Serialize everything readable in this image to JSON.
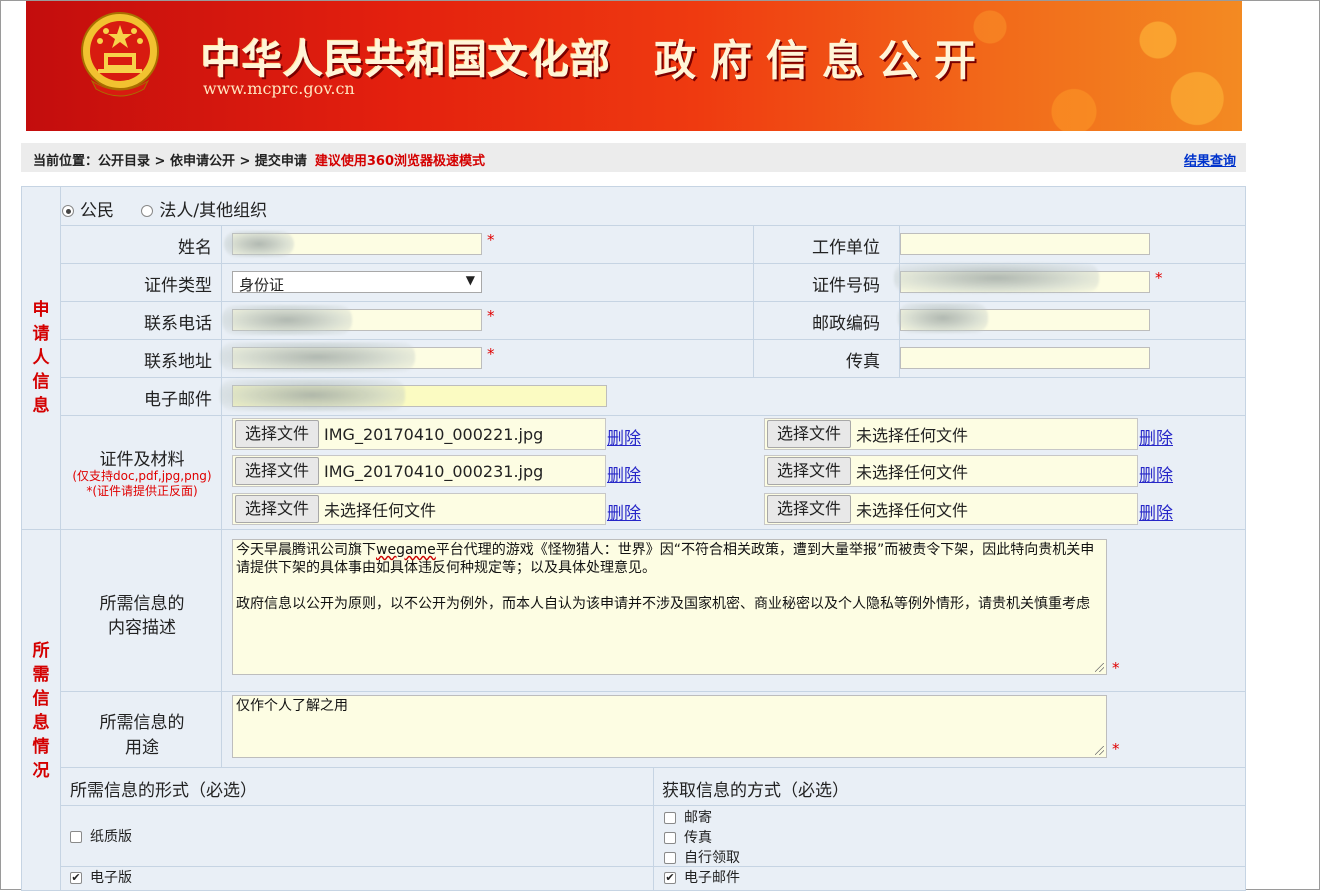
{
  "banner": {
    "title": "中华人民共和国文化部",
    "subtitle": "政府信息公开",
    "url": "www.mcprc.gov.cn",
    "emblem_icon": "national-emblem-icon"
  },
  "breadcrumb": {
    "path": "当前位置：公开目录 > 依申请公开 > 提交申请",
    "tip": "建议使用360浏览器极速模式",
    "result_link": "结果查询"
  },
  "applicant": {
    "section_label": "申请人信息",
    "type_options": [
      {
        "label": "公民",
        "selected": true
      },
      {
        "label": "法人/其他组织",
        "selected": false
      }
    ],
    "name_label": "姓名",
    "work_unit_label": "工作单位",
    "id_type_label": "证件类型",
    "id_type_value": "身份证",
    "id_number_label": "证件号码",
    "phone_label": "联系电话",
    "postcode_label": "邮政编码",
    "address_label": "联系地址",
    "fax_label": "传真",
    "email_label": "电子邮件",
    "required_mark": "*"
  },
  "materials": {
    "label": "证件及材料",
    "note1": "(仅支持doc,pdf,jpg,png)",
    "note2": "*(证件请提供正反面)",
    "choose_label": "选择文件",
    "delete_label": "删除",
    "files": [
      "IMG_20170410_000221.jpg",
      "未选择任何文件",
      "IMG_20170410_000231.jpg",
      "未选择任何文件",
      "未选择任何文件",
      "未选择任何文件"
    ]
  },
  "info": {
    "section_label": "所需信息情况",
    "desc_label_1": "所需信息的",
    "desc_label_2": "内容描述",
    "desc_text_pre": "今天早晨腾讯公司旗下",
    "desc_text_u": "wegame",
    "desc_text_post": "平台代理的游戏《怪物猎人：世界》因“不符合相关政策，遭到大量举报”而被责令下架，因此特向贵机关申请提供下架的具体事由如具体违反何种规定等；以及具体处理意见。\n\n政府信息以公开为原则，以不公开为例外，而本人自认为该申请并不涉及国家机密、商业秘密以及个人隐私等例外情形，请贵机关慎重考虑",
    "use_label_1": "所需信息的",
    "use_label_2": "用途",
    "use_text": "仅作个人了解之用",
    "form_header": "所需信息的形式（必选）",
    "method_header": "获取信息的方式（必选）",
    "forms": [
      {
        "label": "纸质版",
        "checked": false
      },
      {
        "label": "电子版",
        "checked": true
      }
    ],
    "methods": [
      {
        "label": "邮寄",
        "checked": false
      },
      {
        "label": "传真",
        "checked": false
      },
      {
        "label": "自行领取",
        "checked": false
      },
      {
        "label": "电子邮件",
        "checked": true
      }
    ],
    "check_mark": "✔"
  }
}
